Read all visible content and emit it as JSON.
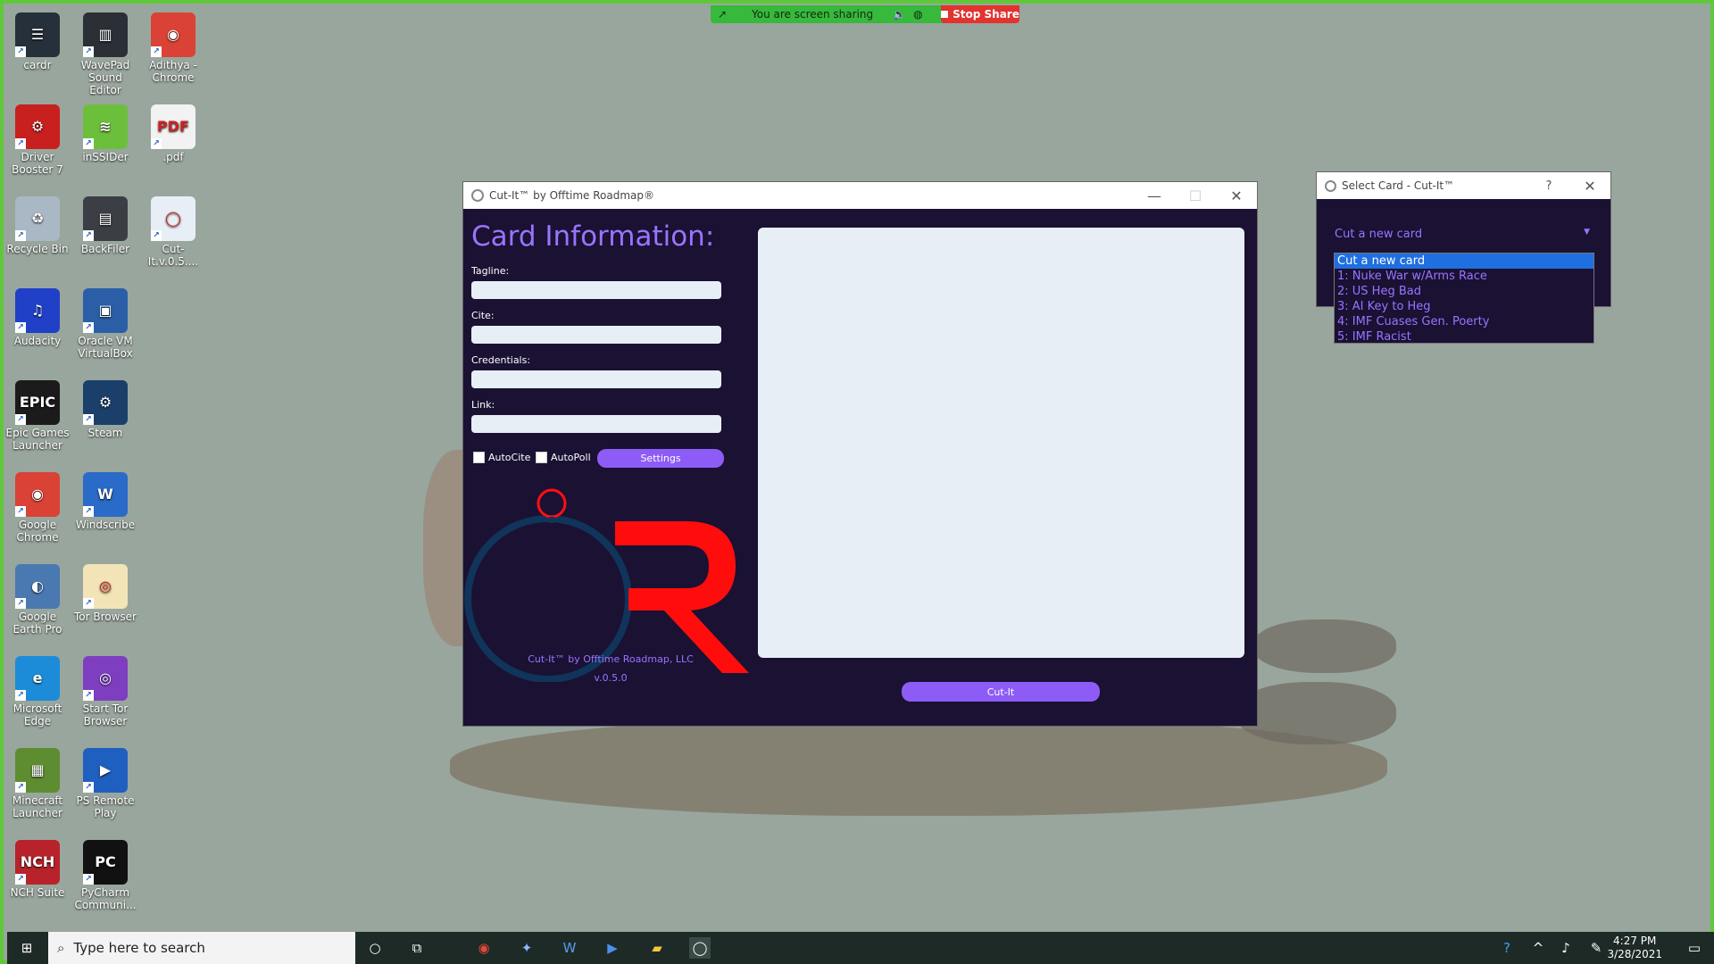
{
  "desktop_icons": [
    {
      "label": "cardr",
      "color": "#26303a",
      "glyph": "☰"
    },
    {
      "label": "WavePad Sound Editor",
      "color": "#2b2f36",
      "glyph": "▥"
    },
    {
      "label": "Adithya - Chrome",
      "color": "#d94235",
      "glyph": "◉"
    },
    {
      "label": "Driver Booster 7",
      "color": "#c8201e",
      "glyph": "⚙"
    },
    {
      "label": "inSSIDer",
      "color": "#6cbf3b",
      "glyph": "≋"
    },
    {
      "label": ".pdf",
      "color": "#f2f2f2",
      "glyph": "PDF"
    },
    {
      "label": "Recycle Bin",
      "color": "#aab7c4",
      "glyph": "♻"
    },
    {
      "label": "BackFiler",
      "color": "#3b3f45",
      "glyph": "▤"
    },
    {
      "label": "Cut-It.v.0.5....",
      "color": "#e8eef6",
      "glyph": "◯"
    },
    {
      "label": "Audacity",
      "color": "#2040c8",
      "glyph": "♫"
    },
    {
      "label": "Oracle VM VirtualBox",
      "color": "#2a5fa8",
      "glyph": "▣"
    },
    {
      "label": "Epic Games Launcher",
      "color": "#1b1b1b",
      "glyph": "EPIC"
    },
    {
      "label": "Steam",
      "color": "#1b3f6b",
      "glyph": "⚙"
    },
    {
      "label": "Google Chrome",
      "color": "#d94235",
      "glyph": "◉"
    },
    {
      "label": "Windscribe",
      "color": "#2a6ac8",
      "glyph": "W"
    },
    {
      "label": "Google Earth Pro",
      "color": "#4a78b0",
      "glyph": "◐"
    },
    {
      "label": "Tor Browser",
      "color": "#f3e4b8",
      "glyph": "◎"
    },
    {
      "label": "Microsoft Edge",
      "color": "#1c8cd8",
      "glyph": "e"
    },
    {
      "label": "Start Tor Browser",
      "color": "#7d3fc0",
      "glyph": "◎"
    },
    {
      "label": "Minecraft Launcher",
      "color": "#5e8c31",
      "glyph": "▦"
    },
    {
      "label": "PS Remote Play",
      "color": "#1f5fc0",
      "glyph": "▶"
    },
    {
      "label": "NCH Suite",
      "color": "#b8232b",
      "glyph": "NCH"
    },
    {
      "label": "PyCharm Communi...",
      "color": "#111111",
      "glyph": "PC"
    }
  ],
  "share_bar": {
    "text": "You are screen sharing",
    "stop_label": "Stop Share"
  },
  "main_window": {
    "title": "Cut-It™ by Offtime Roadmap®",
    "heading": "Card Information:",
    "fields": {
      "tagline": "Tagline:",
      "cite": "Cite:",
      "credentials": "Credentials:",
      "link": "Link:"
    },
    "autocite": "AutoCite",
    "autopoll": "AutoPoll",
    "settings": "Settings",
    "credit": "Cut-It™ by Offtime Roadmap, LLC",
    "version": "v.0.5.0",
    "cut_button": "Cut-It"
  },
  "dialog": {
    "title": "Select Card - Cut-It™",
    "help": "?",
    "selected": "Cut a new card",
    "options": [
      "Cut a new card",
      "1: Nuke War w/Arms Race",
      "2: US Heg Bad",
      "3: AI Key to Heg",
      "4: IMF Cuases Gen. Poerty",
      "5: IMF Racist"
    ]
  },
  "taskbar": {
    "search_placeholder": "Type here to search",
    "time": "4:27 PM",
    "date": "3/28/2021"
  },
  "colors": {
    "accent": "#8d5cf6",
    "window_bg": "#1a1133",
    "desktop_bg": "#99a69d",
    "selection": "#1f6fe0"
  }
}
